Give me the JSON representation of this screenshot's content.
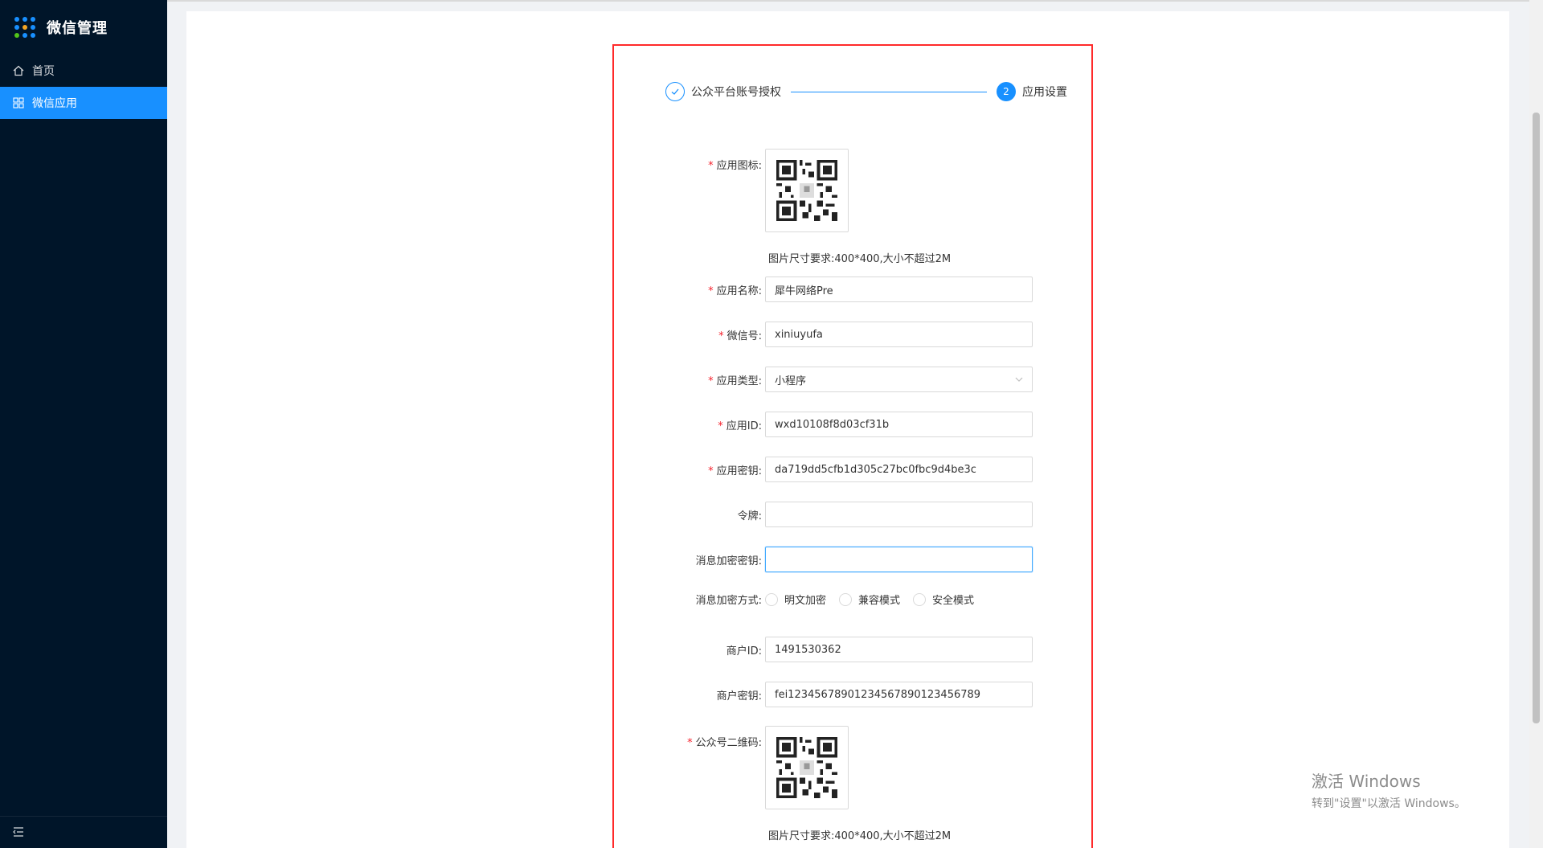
{
  "sidebar": {
    "app_title": "微信管理",
    "items": [
      {
        "label": "首页",
        "icon": "home-icon"
      },
      {
        "label": "微信应用",
        "icon": "app-icon"
      }
    ]
  },
  "steps": [
    {
      "title": "公众平台账号授权",
      "status": "done"
    },
    {
      "number": "2",
      "title": "应用设置",
      "status": "current"
    }
  ],
  "form": {
    "app_icon": {
      "label": "应用图标:",
      "required": true,
      "hint": "图片尺寸要求:400*400,大小不超过2M"
    },
    "app_name": {
      "label": "应用名称:",
      "required": true,
      "value": "犀牛网络Pre"
    },
    "wechat_id": {
      "label": "微信号:",
      "required": true,
      "value": "xiniuyufa"
    },
    "app_type": {
      "label": "应用类型:",
      "required": true,
      "value": "小程序"
    },
    "app_id": {
      "label": "应用ID:",
      "required": true,
      "value": "wxd10108f8d03cf31b"
    },
    "app_secret": {
      "label": "应用密钥:",
      "required": true,
      "value": "da719dd5cfb1d305c27bc0fbc9d4be3c"
    },
    "token": {
      "label": "令牌:",
      "required": false,
      "value": ""
    },
    "msg_key": {
      "label": "消息加密密钥:",
      "required": false,
      "value": ""
    },
    "encrypt_mode": {
      "label": "消息加密方式:",
      "options": [
        "明文加密",
        "兼容模式",
        "安全模式"
      ]
    },
    "merchant_id": {
      "label": "商户ID:",
      "required": false,
      "value": "1491530362"
    },
    "merchant_secret": {
      "label": "商户密钥:",
      "required": false,
      "value": "fei12345678901234567890123456789"
    },
    "qr_code": {
      "label": "公众号二维码:",
      "required": true,
      "hint": "图片尺寸要求:400*400,大小不超过2M"
    }
  },
  "watermark": {
    "title": "激活 Windows",
    "subtitle": "转到\"设置\"以激活 Windows。"
  },
  "colors": {
    "sidebar_bg": "#001529",
    "primary": "#1890ff",
    "required": "#f5222d",
    "highlight_border": "#ff2a2a"
  }
}
